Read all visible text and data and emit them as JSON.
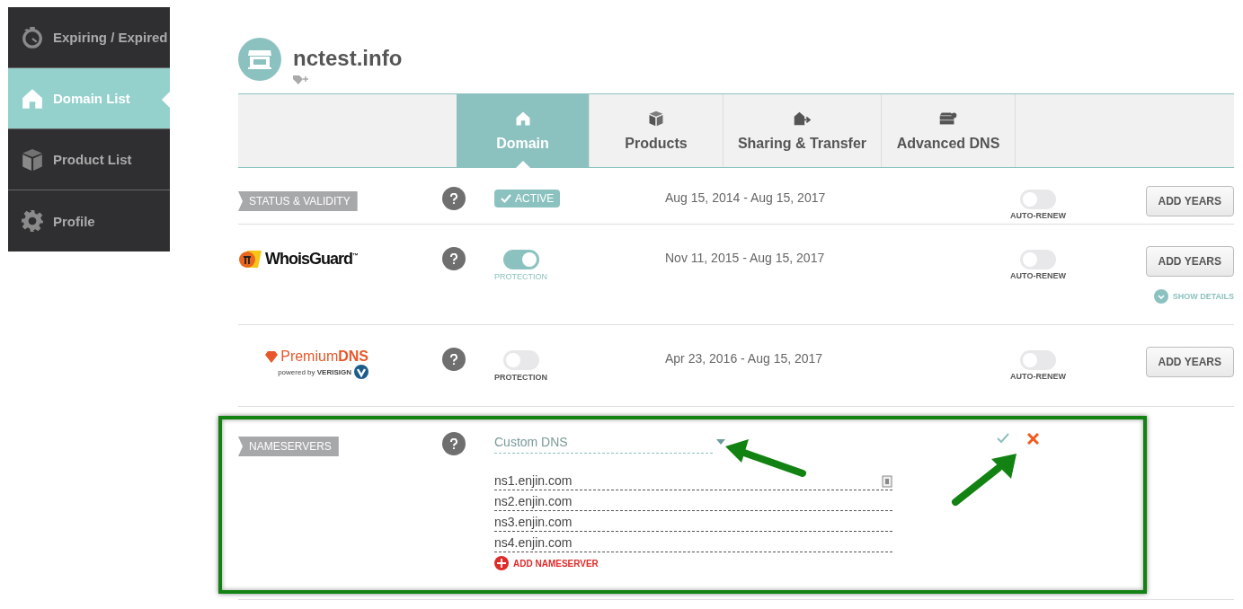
{
  "sidebar": {
    "items": [
      {
        "label": "Expiring / Expired",
        "selected": false
      },
      {
        "label": "Domain List",
        "selected": true
      },
      {
        "label": "Product List",
        "selected": false
      },
      {
        "label": "Profile",
        "selected": false
      }
    ]
  },
  "domain": {
    "name": "nctest.info"
  },
  "tabs": [
    {
      "label": "Domain",
      "selected": true
    },
    {
      "label": "Products",
      "selected": false
    },
    {
      "label": "Sharing & Transfer",
      "selected": false
    },
    {
      "label": "Advanced DNS",
      "selected": false
    }
  ],
  "rows": [
    {
      "kind": "status",
      "label": "STATUS & VALIDITY",
      "badge": "ACTIVE",
      "dates": "Aug 15, 2014 - Aug 15, 2017",
      "auto_renew": {
        "on": false,
        "label": "AUTO-RENEW"
      },
      "button": "ADD YEARS"
    },
    {
      "kind": "whoisguard",
      "logo": "WhoisGuard",
      "logo_mark": "™",
      "protection": {
        "on": true,
        "label": "PROTECTION"
      },
      "dates": "Nov 11, 2015 - Aug 15, 2017",
      "auto_renew": {
        "on": false,
        "label": "AUTO-RENEW"
      },
      "button": "ADD YEARS",
      "details_link": "SHOW DETAILS"
    },
    {
      "kind": "premiumdns",
      "logo": "Premium**DNS**",
      "logo_sub": "powered by **VERISIGN**",
      "protection": {
        "on": false,
        "label": "PROTECTION"
      },
      "dates": "Apr 23, 2016 - Aug 15, 2017",
      "auto_renew": {
        "on": false,
        "label": "AUTO-RENEW"
      },
      "button": "ADD YEARS"
    }
  ],
  "nameservers": {
    "label": "NAMESERVERS",
    "mode": "Custom DNS",
    "entries": [
      "ns1.enjin.com",
      "ns2.enjin.com",
      "ns3.enjin.com",
      "ns4.enjin.com"
    ],
    "add_label": "ADD NAMESERVER"
  }
}
